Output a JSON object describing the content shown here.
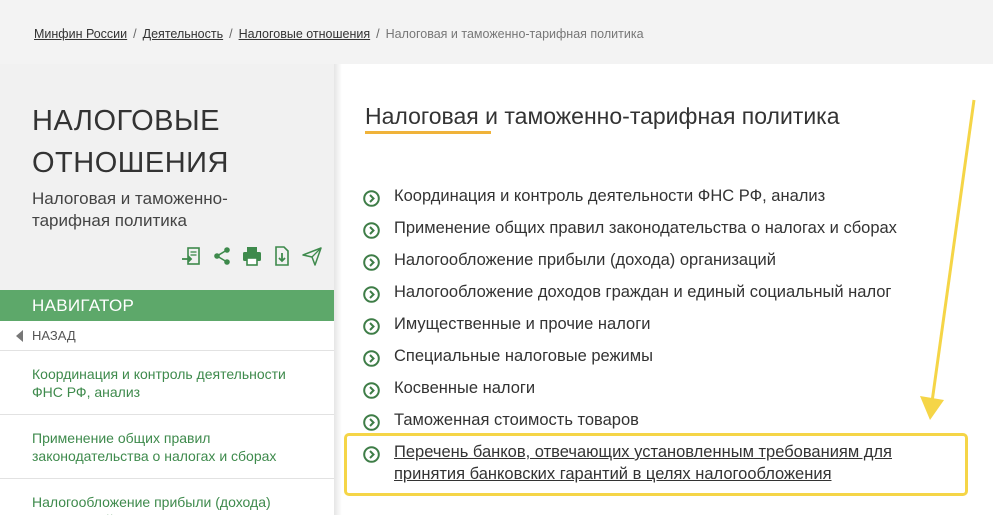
{
  "breadcrumb": {
    "items": [
      "Минфин России",
      "Деятельность",
      "Налоговые отношения"
    ],
    "current": "Налоговая и таможенно-тарифная политика",
    "separator": "/"
  },
  "sidebar": {
    "title_line1": "НАЛОГОВЫЕ",
    "title_line2": "ОТНОШЕНИЯ",
    "subtitle": "Налоговая и таможенно-тарифная политика",
    "tools": [
      "export-icon",
      "share-icon",
      "print-icon",
      "download-icon",
      "send-icon"
    ],
    "navigator_label": "НАВИГАТОР",
    "back_label": "НАЗАД",
    "items": [
      "Координация и контроль деятельности ФНС РФ, анализ",
      "Применение общих правил законодательства о налогах и сборах",
      "Налогообложение прибыли (дохода) организаций"
    ]
  },
  "main": {
    "title": "Налоговая и таможенно-тарифная политика",
    "links": [
      "Координация и контроль деятельности ФНС РФ, анализ",
      "Применение общих правил законодательства о налогах и сборах",
      "Налогообложение прибыли (дохода) организаций",
      "Налогообложение доходов граждан и единый социальный налог",
      "Имущественные и прочие налоги",
      "Специальные налоговые режимы",
      "Косвенные налоги",
      "Таможенная стоимость товаров"
    ],
    "highlighted_link_line1": "Перечень банков, отвечающих установленным требованиям для",
    "highlighted_link_line2": "принятия банковских гарантий в целях налогообложения"
  },
  "colors": {
    "accent_green": "#5da86a",
    "link_green": "#3e8a4c",
    "underline_orange": "#f0b33a",
    "highlight_yellow": "#f5d547"
  }
}
